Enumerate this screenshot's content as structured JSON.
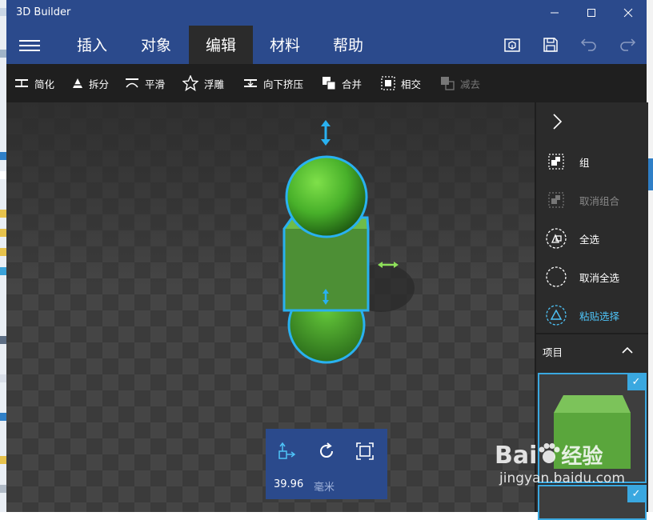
{
  "window": {
    "title": "3D Builder",
    "minimize_icon": "minimize-icon",
    "maximize_icon": "maximize-icon",
    "close_icon": "close-icon"
  },
  "menubar": {
    "tabs": [
      {
        "label": "插入",
        "active": false
      },
      {
        "label": "对象",
        "active": false
      },
      {
        "label": "编辑",
        "active": true
      },
      {
        "label": "材料",
        "active": false
      },
      {
        "label": "帮助",
        "active": false
      }
    ],
    "icons": [
      "view-3d-icon",
      "save-icon",
      "undo-icon",
      "redo-icon"
    ]
  },
  "toolbar": {
    "items": [
      {
        "label": "简化",
        "icon": "simplify-icon",
        "enabled": true
      },
      {
        "label": "拆分",
        "icon": "split-icon",
        "enabled": true
      },
      {
        "label": "平滑",
        "icon": "smooth-icon",
        "enabled": true
      },
      {
        "label": "浮雕",
        "icon": "emboss-star-icon",
        "enabled": true
      },
      {
        "label": "向下挤压",
        "icon": "extrude-down-icon",
        "enabled": true
      },
      {
        "label": "合并",
        "icon": "merge-icon",
        "enabled": true
      },
      {
        "label": "相交",
        "icon": "intersect-icon",
        "enabled": true
      },
      {
        "label": "减去",
        "icon": "subtract-icon",
        "enabled": false
      }
    ]
  },
  "side_panel": {
    "collapse_icon": "chevron-right-icon",
    "items": [
      {
        "label": "组",
        "icon": "group-icon",
        "state": "enabled"
      },
      {
        "label": "取消组合",
        "icon": "ungroup-icon",
        "state": "disabled"
      },
      {
        "label": "全选",
        "icon": "select-all-icon",
        "state": "enabled"
      },
      {
        "label": "取消全选",
        "icon": "deselect-all-icon",
        "state": "enabled"
      },
      {
        "label": "粘贴选择",
        "icon": "sticky-selection-icon",
        "state": "accent"
      }
    ],
    "projects_label": "项目",
    "projects_toggle_icon": "chevron-up-icon",
    "check_mark": "✓"
  },
  "bottom_panel": {
    "icons": [
      "move-icon",
      "rotate-icon",
      "scale-icon"
    ],
    "value": "39.96",
    "unit": "毫米"
  },
  "watermark": {
    "brand": "Bai",
    "brand_suffix": "经验",
    "url": "jingyan.baidu.com"
  },
  "colors": {
    "title_bar": "#2b4a8c",
    "toolbar": "#1f1f1f",
    "accent": "#3aa8e0",
    "object_green": "#4db530"
  }
}
